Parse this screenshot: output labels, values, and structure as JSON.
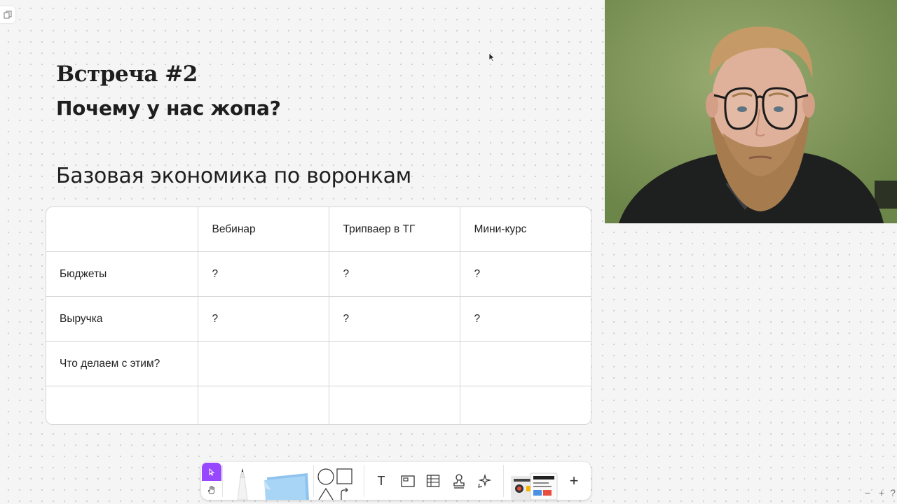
{
  "slide": {
    "title": "Встреча #2",
    "subtitle": "Почему у нас жопа?",
    "section_title": "Базовая экономика по воронкам"
  },
  "table": {
    "columns": [
      "",
      "Вебинар",
      "Трипваер в ТГ",
      "Мини-курс"
    ],
    "rows": [
      [
        "Бюджеты",
        "?",
        "?",
        "?"
      ],
      [
        "Выручка",
        "?",
        "?",
        "?"
      ],
      [
        "Что делаем с этим?",
        "",
        "",
        ""
      ],
      [
        "",
        "",
        "",
        ""
      ]
    ]
  },
  "toolbar": {
    "tools": [
      "select-icon",
      "hand-icon",
      "pen-icon",
      "sticky-note-icon",
      "shapes-icon",
      "text-icon",
      "frame-icon",
      "table-icon",
      "stamp-icon",
      "ai-sparkle-icon",
      "templates-icon",
      "plus-icon"
    ],
    "text_tool_label": "T",
    "plus_label": "+"
  },
  "zoom_controls": {
    "minus": "−",
    "plus": "+",
    "help": "?"
  },
  "colors": {
    "accent": "#9747ff",
    "canvas": "#f5f5f5",
    "video_bg": "#7f9559",
    "sticky": "#a8d4f5"
  }
}
